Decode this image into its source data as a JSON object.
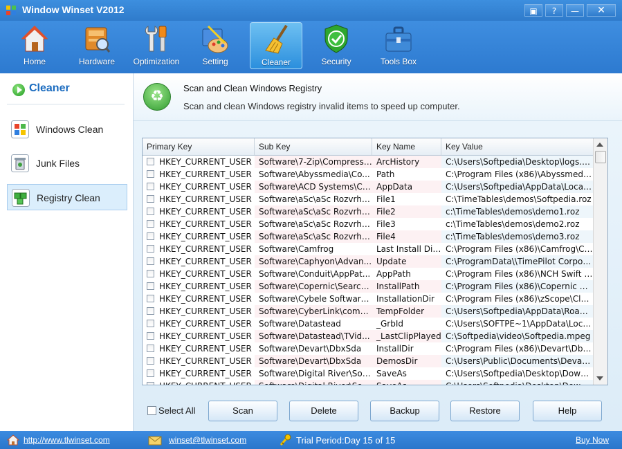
{
  "window": {
    "title": "Window Winset V2012",
    "controls": [
      "▣",
      "?",
      "—",
      "✕"
    ]
  },
  "toolbar": {
    "items": [
      {
        "label": "Home",
        "icon": "home-icon"
      },
      {
        "label": "Hardware",
        "icon": "hardware-icon"
      },
      {
        "label": "Optimization",
        "icon": "optimization-icon"
      },
      {
        "label": "Setting",
        "icon": "setting-icon"
      },
      {
        "label": "Cleaner",
        "icon": "broom-icon",
        "active": true
      },
      {
        "label": "Security",
        "icon": "shield-check-icon"
      },
      {
        "label": "Tools Box",
        "icon": "toolbox-icon"
      }
    ]
  },
  "sidebar": {
    "heading": "Cleaner",
    "items": [
      {
        "label": "Windows Clean",
        "icon": "windows-logo-icon"
      },
      {
        "label": "Junk Files",
        "icon": "trash-icon"
      },
      {
        "label": "Registry Clean",
        "icon": "registry-cubes-icon",
        "active": true
      }
    ]
  },
  "panel": {
    "title": "Scan and Clean Windows Registry",
    "subtitle": "Scan and clean Windows registry invalid items to speed up computer."
  },
  "table": {
    "columns": [
      "Primary Key",
      "Sub Key",
      "Key Name",
      "Key Value"
    ],
    "rows": [
      [
        "HKEY_CURRENT_USER",
        "Software\\7-Zip\\Compression",
        "ArcHistory",
        "C:\\Users\\Softpedia\\Desktop\\logs.zip..."
      ],
      [
        "HKEY_CURRENT_USER",
        "Software\\Abyssmedia\\Co...",
        "Path",
        "C:\\Program Files (x86)\\Abyssmedia\\..."
      ],
      [
        "HKEY_CURRENT_USER",
        "Software\\ACD Systems\\Cr...",
        "AppData",
        "C:\\Users\\Softpedia\\AppData\\Local\\..."
      ],
      [
        "HKEY_CURRENT_USER",
        "Software\\aSc\\aSc Rozvrhy...",
        "File1",
        "C:\\TimeTables\\demos\\Softpedia.roz"
      ],
      [
        "HKEY_CURRENT_USER",
        "Software\\aSc\\aSc Rozvrhy...",
        "File2",
        "c:\\TimeTables\\demos\\demo1.roz"
      ],
      [
        "HKEY_CURRENT_USER",
        "Software\\aSc\\aSc Rozvrhy...",
        "File3",
        "c:\\TimeTables\\demos\\demo2.roz"
      ],
      [
        "HKEY_CURRENT_USER",
        "Software\\aSc\\aSc Rozvrhy...",
        "File4",
        "c:\\TimeTables\\demos\\demo3.roz"
      ],
      [
        "HKEY_CURRENT_USER",
        "Software\\Camfrog",
        "Last Install Dir...",
        "C:\\Program Files (x86)\\Camfrog\\Ca..."
      ],
      [
        "HKEY_CURRENT_USER",
        "Software\\Caphyon\\Advan...",
        "Update",
        "C:\\ProgramData\\\\TimePilot Corpora..."
      ],
      [
        "HKEY_CURRENT_USER",
        "Software\\Conduit\\AppPat...",
        "AppPath",
        "C:\\Program Files (x86)\\NCH Swift S..."
      ],
      [
        "HKEY_CURRENT_USER",
        "Software\\Copernic\\Search...",
        "InstallPath",
        "C:\\Program Files (x86)\\Copernic De..."
      ],
      [
        "HKEY_CURRENT_USER",
        "Software\\Cybele Software...",
        "InstallationDir",
        "C:\\Program Files (x86)\\zScope\\Class..."
      ],
      [
        "HKEY_CURRENT_USER",
        "Software\\CyberLink\\comm...",
        "TempFolder",
        "C:\\Users\\Softpedia\\AppData\\Roami..."
      ],
      [
        "HKEY_CURRENT_USER",
        "Software\\Datastead",
        "_GrbId",
        "C:\\Users\\SOFTPE~1\\AppData\\Local..."
      ],
      [
        "HKEY_CURRENT_USER",
        "Software\\Datastead\\TVid...",
        "_LastClipPlayed",
        "C:\\Softpedia\\video\\Softpedia.mpeg"
      ],
      [
        "HKEY_CURRENT_USER",
        "Software\\Devart\\DbxSda",
        "InstallDir",
        "C:\\Program Files (x86)\\Devart\\Dbx\\..."
      ],
      [
        "HKEY_CURRENT_USER",
        "Software\\Devart\\DbxSda",
        "DemosDir",
        "C:\\Users\\Public\\Documents\\Devart\\..."
      ],
      [
        "HKEY_CURRENT_USER",
        "Software\\Digital River\\Soft...",
        "SaveAs",
        "C:\\Users\\Softpedia\\Desktop\\Downl..."
      ],
      [
        "HKEY_CURRENT_USER",
        "Software\\Digital River\\Soft...",
        "SaveAs",
        "C:\\Users\\Softpedia\\Desktop\\Downl..."
      ]
    ]
  },
  "actions": {
    "select_all": "Select All",
    "buttons": [
      "Scan",
      "Delete",
      "Backup",
      "Restore",
      "Help"
    ]
  },
  "status": {
    "website": "http://www.tlwinset.com",
    "email": "winset@tlwinset.com",
    "trial": "Trial Period:Day 15 of 15",
    "buy": "Buy Now"
  }
}
